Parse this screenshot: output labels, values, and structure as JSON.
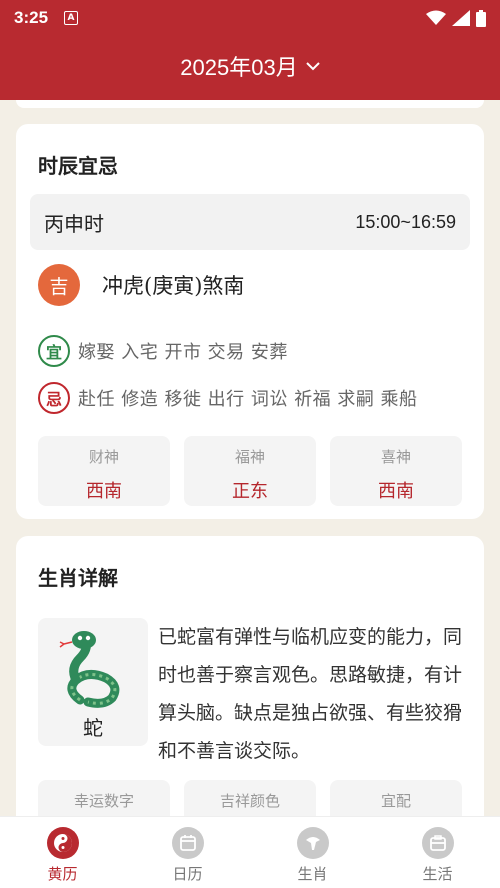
{
  "status": {
    "time": "3:25",
    "app_icon": "A"
  },
  "header": {
    "month": "2025年03月"
  },
  "shichen": {
    "title": "时辰宜忌",
    "period_name": "丙申时",
    "period_time": "15:00~16:59",
    "ji_label": "吉",
    "clash": "冲虎(庚寅)煞南",
    "yi_badge": "宜",
    "yi_items": "嫁娶 入宅 开市 交易 安葬",
    "ji_badge": "忌",
    "ji_items": "赴任 修造 移徙 出行 词讼 祈福 求嗣 乘船",
    "gods": [
      {
        "label": "财神",
        "value": "西南"
      },
      {
        "label": "福神",
        "value": "正东"
      },
      {
        "label": "喜神",
        "value": "西南"
      }
    ]
  },
  "zodiac": {
    "title": "生肖详解",
    "name": "蛇",
    "description": "已蛇富有弹性与临机应变的能力，同时也善于察言观色。思路敏捷，有计算头脑。缺点是独占欲强、有些狡猾和不善言谈交际。",
    "info": [
      {
        "label": "幸运数字"
      },
      {
        "label": "吉祥颜色"
      },
      {
        "label": "宜配"
      }
    ]
  },
  "nav": [
    {
      "label": "黄历",
      "icon": "yin-yang-icon",
      "active": true
    },
    {
      "label": "日历",
      "icon": "calendar-icon",
      "active": false
    },
    {
      "label": "生肖",
      "icon": "zodiac-icon",
      "active": false
    },
    {
      "label": "生活",
      "icon": "life-icon",
      "active": false
    }
  ],
  "colors": {
    "primary": "#b82a30",
    "yi": "#2f8a4a",
    "ji_badge": "#e4683c"
  }
}
